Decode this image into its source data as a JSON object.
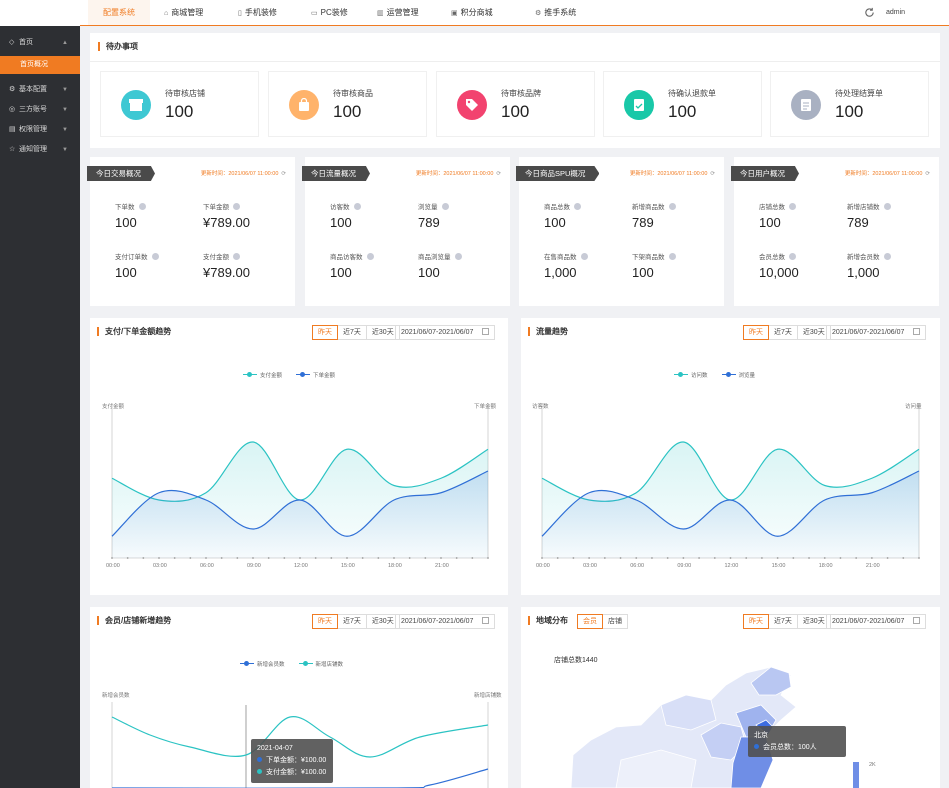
{
  "topnav": {
    "items": [
      {
        "label": "配置系统",
        "icon": ""
      },
      {
        "label": "商城管理",
        "icon": "store-icon"
      },
      {
        "label": "手机装修",
        "icon": "mobile-icon"
      },
      {
        "label": "PC装修",
        "icon": "pc-icon"
      },
      {
        "label": "运营管理",
        "icon": "chart-icon"
      },
      {
        "label": "积分商城",
        "icon": "points-icon"
      },
      {
        "label": "推手系统",
        "icon": "push-icon"
      }
    ],
    "user": "admin"
  },
  "sidebar": {
    "items": [
      {
        "label": "首页"
      },
      {
        "label": "首页概况"
      },
      {
        "label": "基本配置"
      },
      {
        "label": "三方账号"
      },
      {
        "label": "权限管理"
      },
      {
        "label": "通知管理"
      }
    ]
  },
  "todo": {
    "title": "待办事项",
    "items": [
      {
        "label": "待审核店铺",
        "value": "100",
        "color": "#3ec8d3",
        "icon": "shop-icon"
      },
      {
        "label": "待审核商品",
        "value": "100",
        "color": "#ffb36b",
        "icon": "bag-icon"
      },
      {
        "label": "待审核品牌",
        "value": "100",
        "color": "#f2436f",
        "icon": "tag-icon"
      },
      {
        "label": "待确认退款单",
        "value": "100",
        "color": "#19c8a8",
        "icon": "refund-icon"
      },
      {
        "label": "待处理结算单",
        "value": "100",
        "color": "#a9b1c2",
        "icon": "document-icon"
      }
    ]
  },
  "stats": [
    {
      "title": "今日交易概况",
      "updated": "更新时间：2021/06/07 11:00:00",
      "metrics": [
        {
          "label": "下单数",
          "value": "100"
        },
        {
          "label": "下单金额",
          "value": "¥789.00"
        },
        {
          "label": "支付订单数",
          "value": "100"
        },
        {
          "label": "支付金额",
          "value": "¥789.00"
        }
      ]
    },
    {
      "title": "今日流量概况",
      "updated": "更新时间：2021/06/07 11:00:00",
      "metrics": [
        {
          "label": "访客数",
          "value": "100"
        },
        {
          "label": "浏览量",
          "value": "789"
        },
        {
          "label": "商品访客数",
          "value": "100"
        },
        {
          "label": "商品浏览量",
          "value": "100"
        }
      ]
    },
    {
      "title": "今日商品SPU概况",
      "updated": "更新时间：2021/06/07 11:00:00",
      "metrics": [
        {
          "label": "商品总数",
          "value": "100"
        },
        {
          "label": "新增商品数",
          "value": "789"
        },
        {
          "label": "在售商品数",
          "value": "1,000"
        },
        {
          "label": "下架商品数",
          "value": "100"
        }
      ]
    },
    {
      "title": "今日用户概况",
      "updated": "更新时间：2021/06/07 11:00:00",
      "metrics": [
        {
          "label": "店铺总数",
          "value": "100"
        },
        {
          "label": "新增店铺数",
          "value": "789"
        },
        {
          "label": "会员总数",
          "value": "10,000"
        },
        {
          "label": "新增会员数",
          "value": "1,000"
        }
      ]
    }
  ],
  "panels": {
    "pay": {
      "title": "支付/下单金额趋势",
      "tabs": [
        "昨天",
        "近7天",
        "近30天"
      ],
      "range": "2021/06/07-2021/06/07"
    },
    "flow": {
      "title": "流量趋势",
      "tabs": [
        "昨天",
        "近7天",
        "近30天"
      ],
      "range": "2021/06/07-2021/06/07"
    },
    "member": {
      "title": "会员/店铺新增趋势",
      "tabs": [
        "昨天",
        "近7天",
        "近30天"
      ],
      "range": "2021/06/07-2021/06/07"
    },
    "region": {
      "title": "地域分布",
      "toggle": [
        "会员",
        "店铺"
      ],
      "tabs": [
        "昨天",
        "近7天",
        "近30天"
      ],
      "range": "2021/06/07-2021/06/07",
      "total_label": "店铺总数1440",
      "scale_label": "2K"
    }
  },
  "map_tooltip": {
    "title": "北京",
    "text": "会员总数：100人"
  },
  "member_tooltip": {
    "title": "2021-04-07",
    "rows": [
      "下单金额：¥100.00",
      "支付金额：¥100.00"
    ]
  },
  "chart_data": [
    {
      "type": "line",
      "title": "支付/下单金额趋势",
      "x": [
        "00:00",
        "03:00",
        "06:00",
        "09:00",
        "12:00",
        "15:00",
        "18:00",
        "21:00"
      ],
      "ylabel_left": "支付金额",
      "ylabel_right": "下单金额",
      "series": [
        {
          "name": "支付金额",
          "color": "#2bc3c3",
          "values": [
            55,
            40,
            45,
            80,
            40,
            75,
            50,
            55,
            75
          ]
        },
        {
          "name": "下单金额",
          "color": "#2f6fd6",
          "values": [
            15,
            45,
            40,
            20,
            40,
            15,
            40,
            45,
            60
          ]
        }
      ]
    },
    {
      "type": "line",
      "title": "流量趋势",
      "x": [
        "00:00",
        "03:00",
        "06:00",
        "09:00",
        "12:00",
        "15:00",
        "18:00",
        "21:00"
      ],
      "ylabel_left": "访客数",
      "ylabel_right": "访问量",
      "series": [
        {
          "name": "访问数",
          "color": "#2bc3c3",
          "values": [
            55,
            40,
            45,
            80,
            40,
            75,
            50,
            55,
            75
          ]
        },
        {
          "name": "浏览量",
          "color": "#2f6fd6",
          "values": [
            15,
            45,
            40,
            20,
            40,
            15,
            40,
            45,
            60
          ]
        }
      ]
    },
    {
      "type": "line",
      "title": "会员/店铺新增趋势",
      "ylabel_left": "新增会员数",
      "ylabel_right": "新增店铺数",
      "series": [
        {
          "name": "新增会员数",
          "color": "#2f6fd6"
        },
        {
          "name": "新增店铺数",
          "color": "#2bc3c3"
        }
      ]
    }
  ]
}
